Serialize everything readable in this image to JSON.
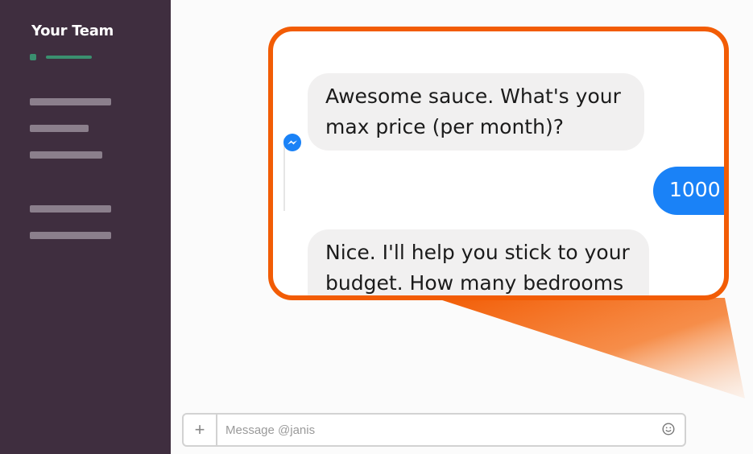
{
  "sidebar": {
    "team_name": "Your Team"
  },
  "chat": {
    "messages": [
      {
        "direction": "incoming",
        "text": "Awesome sauce. What's your max price (per month)?"
      },
      {
        "direction": "outgoing",
        "text": "1000"
      },
      {
        "direction": "incoming",
        "text": "Nice. I'll help you stick to your budget. How many bedrooms"
      }
    ]
  },
  "composer": {
    "placeholder": "Message @janis",
    "value": ""
  },
  "colors": {
    "sidebar_bg": "#3f2e3f",
    "presence_green": "#3a8f6f",
    "callout_orange": "#f25c05",
    "messenger_blue": "#1a82f7"
  },
  "icons": {
    "messenger": "messenger-icon",
    "plus": "plus-icon",
    "emoji": "emoji-icon"
  }
}
